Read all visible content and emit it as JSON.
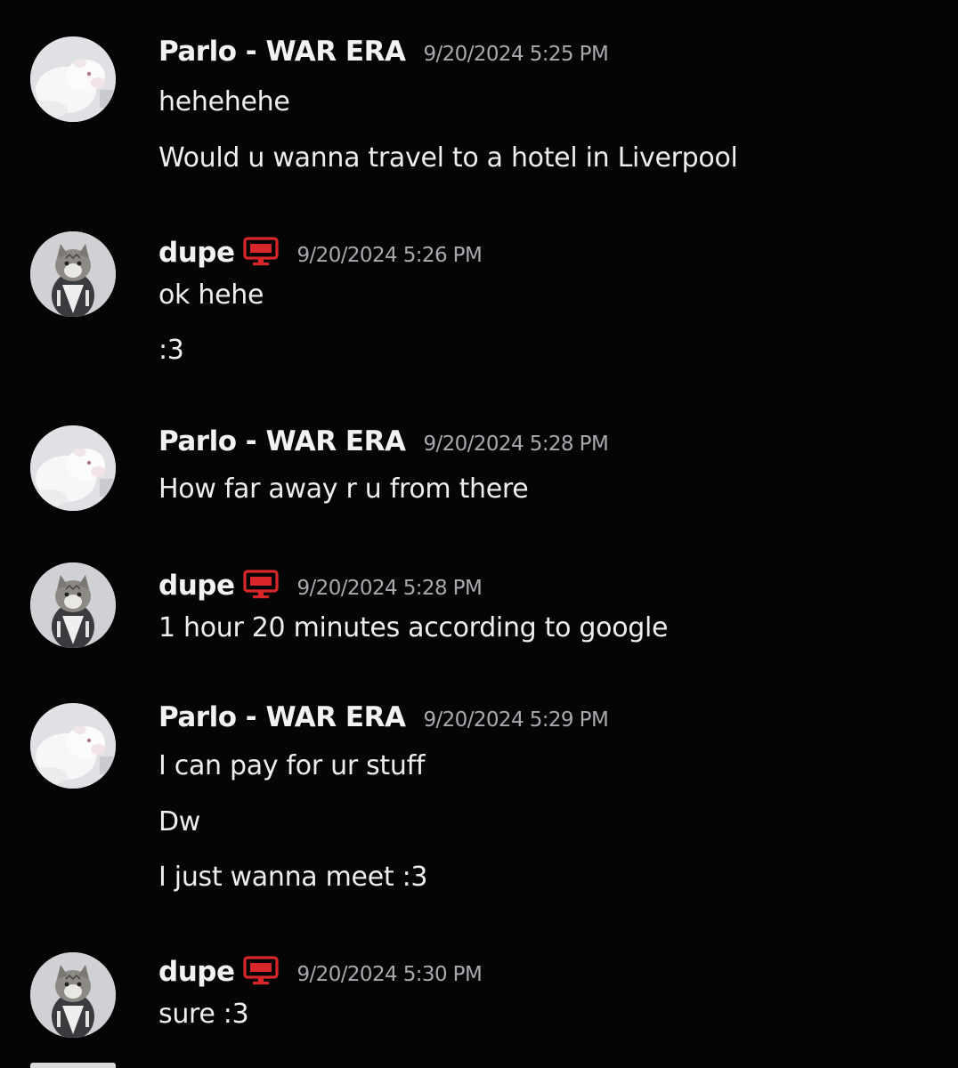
{
  "messages": [
    {
      "user": "Parlo - WAR ERA",
      "avatar": "white-ferret-avatar",
      "timestamp": "9/20/2024 5:25 PM",
      "lines": [
        "hehehehe",
        "Would u wanna travel to a hotel in Liverpool"
      ]
    },
    {
      "user": "dupe",
      "avatar": "kitten-avatar",
      "device_icon": "desktop-monitor-icon",
      "timestamp": "9/20/2024 5:26 PM",
      "lines": [
        "ok hehe",
        ":3"
      ]
    },
    {
      "user": "Parlo - WAR ERA",
      "avatar": "white-ferret-avatar",
      "timestamp": "9/20/2024 5:28 PM",
      "lines": [
        "How far away r u from there"
      ]
    },
    {
      "user": "dupe",
      "avatar": "kitten-avatar",
      "device_icon": "desktop-monitor-icon",
      "timestamp": "9/20/2024 5:28 PM",
      "lines": [
        "1 hour 20 minutes according to google"
      ]
    },
    {
      "user": "Parlo - WAR ERA",
      "avatar": "white-ferret-avatar",
      "timestamp": "9/20/2024 5:29 PM",
      "lines": [
        "I can pay for ur stuff",
        "Dw",
        "I just wanna meet :3"
      ]
    },
    {
      "user": "dupe",
      "avatar": "kitten-avatar",
      "device_icon": "desktop-monitor-icon",
      "timestamp": "9/20/2024 5:30 PM",
      "lines": [
        "sure :3"
      ]
    }
  ],
  "colors": {
    "background": "#050506",
    "username": "#f2f2f3",
    "timestamp": "#a9aab0",
    "message_text": "#eeeef0",
    "device_icon": "#d8262b"
  }
}
